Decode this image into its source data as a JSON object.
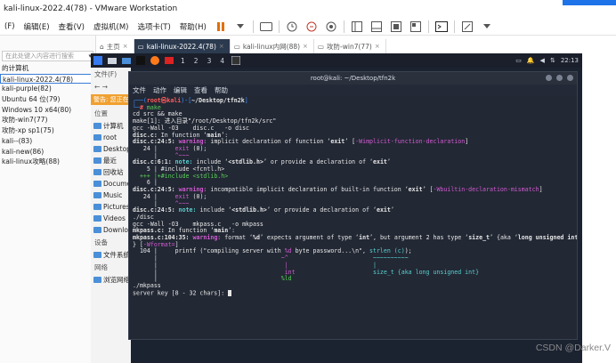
{
  "window": {
    "title": "kali-linux-2022.4(78) - VMware Workstation"
  },
  "menubar": [
    "(F)",
    "编辑(E)",
    "查看(V)",
    "虚拟机(M)",
    "选项卡(T)",
    "帮助(H)"
  ],
  "library": {
    "search_placeholder": "在此处键入内容进行搜索",
    "items": [
      {
        "label": "的计算机",
        "selected": false
      },
      {
        "label": "kali-linux-2022.4(78)",
        "selected": true
      },
      {
        "label": "kali-purple(82)",
        "selected": false
      },
      {
        "label": "Ubuntu 64 位(79)",
        "selected": false
      },
      {
        "label": "Windows 10 x64(80)",
        "selected": false
      },
      {
        "label": "攻防-win7(77)",
        "selected": false
      },
      {
        "label": "攻防-xp sp1(75)",
        "selected": false
      },
      {
        "label": "kali--(83)",
        "selected": false
      },
      {
        "label": "kali-new(86)",
        "selected": false
      },
      {
        "label": "kali-linux攻略(88)",
        "selected": false
      }
    ]
  },
  "tabs": [
    {
      "label": "主页",
      "active": false
    },
    {
      "label": "kali-linux-2022.4(78)",
      "active": true
    },
    {
      "label": "kali-linux内网(88)",
      "active": false
    },
    {
      "label": "攻防-win7(77)",
      "active": false
    }
  ],
  "kali_panel": {
    "workspaces": [
      "1",
      "2",
      "3",
      "4"
    ],
    "clock": "22:13"
  },
  "file_manager": {
    "menu": "文件(F)",
    "warning": "警告: 您正在",
    "places_header": "位置",
    "places": [
      "计算机",
      "root",
      "Desktop",
      "最近",
      "回收站",
      "Documents",
      "Music",
      "Pictures",
      "Videos",
      "Downloads"
    ],
    "devices_header": "设备",
    "devices": [
      "文件系统"
    ],
    "network_header": "网络",
    "network": [
      "浏览网络"
    ]
  },
  "terminal": {
    "title": "root@kali: ~/Desktop/tfn2k",
    "menu": [
      "文件",
      "动作",
      "编辑",
      "查看",
      "帮助"
    ]
  },
  "watermark": "CSDN @Darker.V",
  "colors": {
    "vmware_accent": "#1e73e8",
    "terminal_bg": "#222834",
    "prompt_blue": "#3e8fff",
    "prompt_red": "#ff5a5a"
  }
}
